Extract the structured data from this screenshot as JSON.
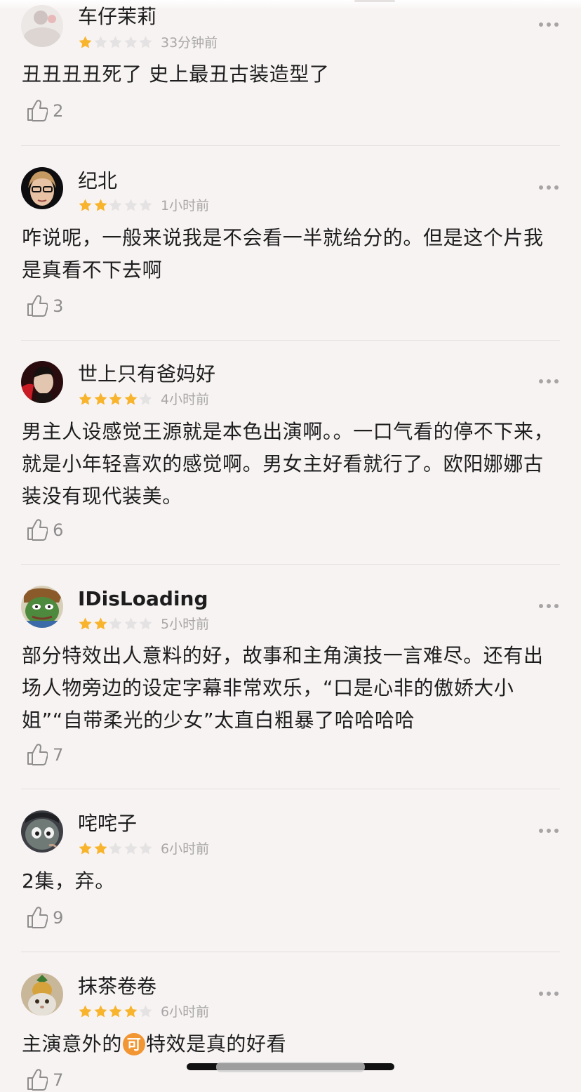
{
  "colors": {
    "star_filled": "#f7b42c",
    "star_empty": "#e4e2e2",
    "background": "#f8f3f3",
    "meta": "#a8a6a6"
  },
  "icons": {
    "like": "thumbs-up-icon",
    "more": "more-dots-icon"
  },
  "max_rating": 5,
  "reviews": [
    {
      "user": "车仔茉莉",
      "rating": 1,
      "time": "33分钟前",
      "text": "丑丑丑丑死了 史上最丑古装造型了",
      "likes": "2"
    },
    {
      "user": "纪北",
      "rating": 2,
      "time": "1小时前",
      "text": "咋说呢，一般来说我是不会看一半就给分的。但是这个片我是真看不下去啊",
      "likes": "3"
    },
    {
      "user": "世上只有爸妈好",
      "rating": 4,
      "time": "4小时前",
      "text": "男主人设感觉王源就是本色出演啊。。一口气看的停不下来，就是小年轻喜欢的感觉啊。男女主好看就行了。欧阳娜娜古装没有现代装美。",
      "likes": "6"
    },
    {
      "user": "IDisLoading",
      "rating": 2,
      "time": "5小时前",
      "text": "部分特效出人意料的好，故事和主角演技一言难尽。还有出场人物旁边的设定字幕非常欢乐，“口是心非的傲娇大小姐”“自带柔光的少女”太直白粗暴了哈哈哈哈",
      "likes": "7"
    },
    {
      "user": "咤咤子",
      "rating": 2,
      "time": "6小时前",
      "text": "2集，弃。",
      "likes": "9"
    },
    {
      "user": "抹茶卷卷",
      "rating": 4,
      "time": "6小时前",
      "text_before": "主演意外的",
      "emoji": "可",
      "text_after": "特效是真的好看",
      "likes": "7"
    }
  ]
}
